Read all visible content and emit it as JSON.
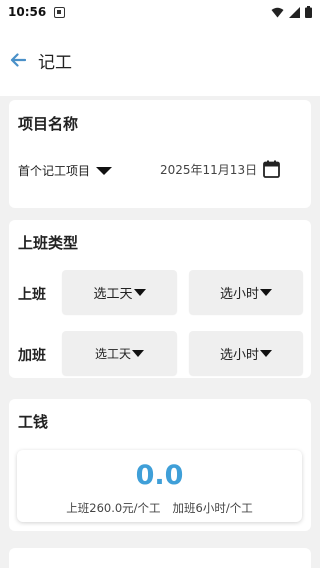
{
  "status_bar": {
    "time": "10:56"
  },
  "header": {
    "title": "记工"
  },
  "project": {
    "section_title": "项目名称",
    "project_name": "首个记工项目",
    "date": "2025年11月13日"
  },
  "shift": {
    "section_title": "上班类型",
    "rows": [
      {
        "label": "上班",
        "day_button": "选工天",
        "hour_button": "选小时"
      },
      {
        "label": "加班",
        "day_button": "选工天",
        "hour_button": "选小时"
      }
    ]
  },
  "wage": {
    "section_title": "工钱",
    "total": "0.0",
    "regular_rate": "上班260.0元/个工",
    "overtime_rate": "加班6小时/个工"
  },
  "colors": {
    "accent": "#3f9fd8",
    "back_arrow": "#4a90c8",
    "background": "#f1f1f1",
    "card": "#ffffff",
    "button": "#efefef"
  },
  "icons": {
    "back": "arrow-left-icon",
    "calendar": "calendar-icon",
    "dropdown": "triangle-down-icon",
    "wifi": "wifi-icon",
    "signal": "signal-icon",
    "battery": "battery-icon",
    "notification": "notification-icon"
  }
}
